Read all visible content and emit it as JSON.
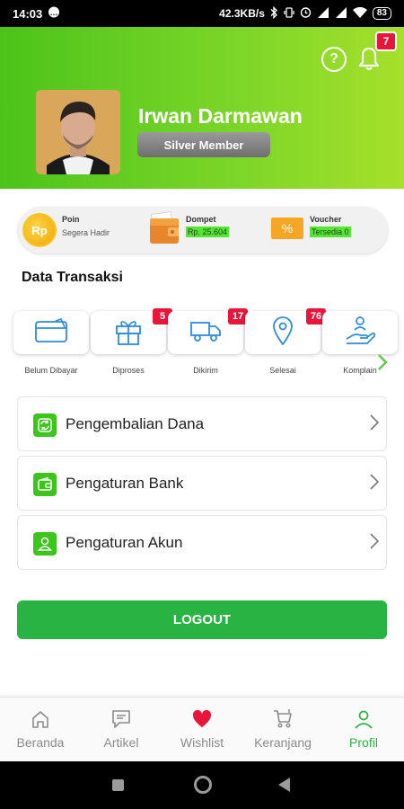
{
  "status_bar": {
    "time": "14:03",
    "net_speed": "42.3KB/s",
    "battery": "83"
  },
  "header": {
    "user_name": "Irwan Darmawan",
    "member_level": "Silver Member",
    "notification_count": "7"
  },
  "wallet": {
    "poin": {
      "label": "Poin",
      "value": "Segera Hadir",
      "icon_text": "Rp"
    },
    "dompet": {
      "label": "Dompet",
      "value": "Rp. 25.604"
    },
    "voucher": {
      "label": "Voucher",
      "value": "Tersedia 0",
      "icon_text": "%"
    }
  },
  "transactions": {
    "title": "Data Transaksi",
    "items": [
      {
        "label": "Belum Dibayar",
        "badge": "",
        "icon": "card-icon"
      },
      {
        "label": "Diproses",
        "badge": "5",
        "icon": "gift-icon"
      },
      {
        "label": "Dikirim",
        "badge": "17",
        "icon": "truck-icon"
      },
      {
        "label": "Selesai",
        "badge": "76",
        "icon": "location-pin-icon"
      },
      {
        "label": "Komplain",
        "badge": "",
        "icon": "support-icon"
      }
    ]
  },
  "menu": {
    "items": [
      {
        "label": "Pengembalian Dana",
        "icon": "refund-icon"
      },
      {
        "label": "Pengaturan Bank",
        "icon": "wallet-icon"
      },
      {
        "label": "Pengaturan Akun",
        "icon": "user-icon"
      }
    ]
  },
  "logout_label": "LOGOUT",
  "bottom_nav": {
    "items": [
      {
        "label": "Beranda",
        "icon": "home-icon",
        "active": false
      },
      {
        "label": "Artikel",
        "icon": "article-icon",
        "active": false
      },
      {
        "label": "Wishlist",
        "icon": "heart-icon",
        "active": false
      },
      {
        "label": "Keranjang",
        "icon": "cart-icon",
        "active": false
      },
      {
        "label": "Profil",
        "icon": "profile-icon",
        "active": true
      }
    ]
  },
  "colors": {
    "brand_green": "#29b343",
    "badge_red": "#e8163a",
    "active_nav": "#29b343"
  }
}
